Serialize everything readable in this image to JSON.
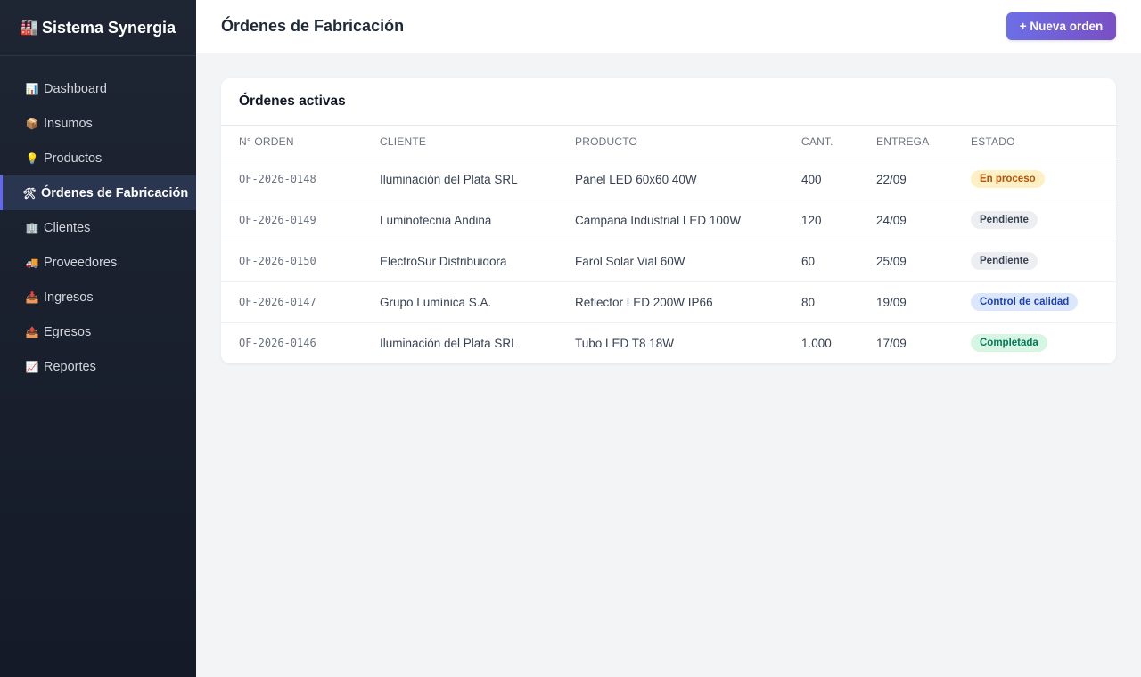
{
  "brand": {
    "icon": "🏭",
    "name": "Sistema Synergia"
  },
  "sidebar": {
    "items": [
      {
        "icon": "📊",
        "icon_name": "chart-icon",
        "label": "Dashboard",
        "active": false
      },
      {
        "icon": "📦",
        "icon_name": "box-icon",
        "label": "Insumos",
        "active": false
      },
      {
        "icon": "💡",
        "icon_name": "lightbulb-icon",
        "label": "Productos",
        "active": false
      },
      {
        "icon": "🛠",
        "icon_name": "tools-icon",
        "label": "Órdenes de Fabricación",
        "active": true
      },
      {
        "icon": "🏢",
        "icon_name": "building-icon",
        "label": "Clientes",
        "active": false
      },
      {
        "icon": "🚚",
        "icon_name": "truck-icon",
        "label": "Proveedores",
        "active": false
      },
      {
        "icon": "📥",
        "icon_name": "inbox-icon",
        "label": "Ingresos",
        "active": false
      },
      {
        "icon": "📤",
        "icon_name": "outbox-icon",
        "label": "Egresos",
        "active": false
      },
      {
        "icon": "📈",
        "icon_name": "trend-icon",
        "label": "Reportes",
        "active": false
      }
    ]
  },
  "header": {
    "title": "Órdenes de Fabricación",
    "new_button": "+ Nueva orden"
  },
  "card": {
    "title": "Órdenes activas",
    "columns": [
      "N° ORDEN",
      "CLIENTE",
      "PRODUCTO",
      "CANT.",
      "ENTREGA",
      "ESTADO"
    ],
    "rows": [
      {
        "orden": "OF-2026-0148",
        "cliente": "Iluminación del Plata SRL",
        "producto": "Panel LED 60x60 40W",
        "cantidad": "400",
        "entrega": "22/09",
        "estado": "En proceso",
        "estado_tipo": "proceso"
      },
      {
        "orden": "OF-2026-0149",
        "cliente": "Luminotecnia Andina",
        "producto": "Campana Industrial LED 100W",
        "cantidad": "120",
        "entrega": "24/09",
        "estado": "Pendiente",
        "estado_tipo": "pendiente"
      },
      {
        "orden": "OF-2026-0150",
        "cliente": "ElectroSur Distribuidora",
        "producto": "Farol Solar Vial 60W",
        "cantidad": "60",
        "entrega": "25/09",
        "estado": "Pendiente",
        "estado_tipo": "pendiente"
      },
      {
        "orden": "OF-2026-0147",
        "cliente": "Grupo Lumínica S.A.",
        "producto": "Reflector LED 200W IP66",
        "cantidad": "80",
        "entrega": "19/09",
        "estado": "Control de calidad",
        "estado_tipo": "calidad"
      },
      {
        "orden": "OF-2026-0146",
        "cliente": "Iluminación del Plata SRL",
        "producto": "Tubo LED T8 18W",
        "cantidad": "1.000",
        "entrega": "17/09",
        "estado": "Completada",
        "estado_tipo": "completada"
      }
    ]
  },
  "colors": {
    "sidebar_bg": "#1e2533",
    "accent": "#6366f1",
    "badge_proceso": "#fdf0c4",
    "badge_pendiente": "#eceef1",
    "badge_calidad": "#dbe7fd",
    "badge_completada": "#d6f5e3"
  }
}
